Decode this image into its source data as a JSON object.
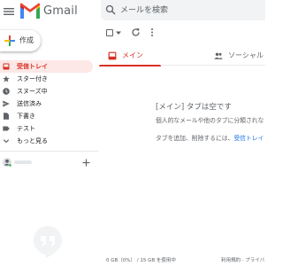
{
  "header": {
    "brand": "Gmail",
    "search_placeholder": "メールを検索"
  },
  "compose": {
    "label": "作成"
  },
  "nav": [
    {
      "label": "受信トレイ",
      "icon": "inbox-icon",
      "active": true
    },
    {
      "label": "スター付き",
      "icon": "star-icon",
      "active": false
    },
    {
      "label": "スヌーズ中",
      "icon": "clock-icon",
      "active": false
    },
    {
      "label": "送信済み",
      "icon": "send-icon",
      "active": false
    },
    {
      "label": "下書き",
      "icon": "draft-icon",
      "active": false
    },
    {
      "label": "テスト",
      "icon": "label-icon",
      "active": false
    },
    {
      "label": "もっと見る",
      "icon": "chevron-down-icon",
      "active": false
    }
  ],
  "tabs": [
    {
      "label": "メイン",
      "icon": "inbox-icon",
      "active": true
    },
    {
      "label": "ソーシャル",
      "icon": "people-icon",
      "active": false
    }
  ],
  "empty_state": {
    "title": "[メイン] タブは空です",
    "line1": "個人的なメールや他のタブに分類されな",
    "line2": "タブを追加、削除するには、",
    "link": "受信トレイ"
  },
  "footer": {
    "storage": "0 GB（0%） / 15 GB を使用中",
    "links": "利用規約 · プライバ"
  },
  "colors": {
    "accent_red": "#d93025",
    "active_bg": "#fce8e6",
    "link_blue": "#1a73e8"
  }
}
